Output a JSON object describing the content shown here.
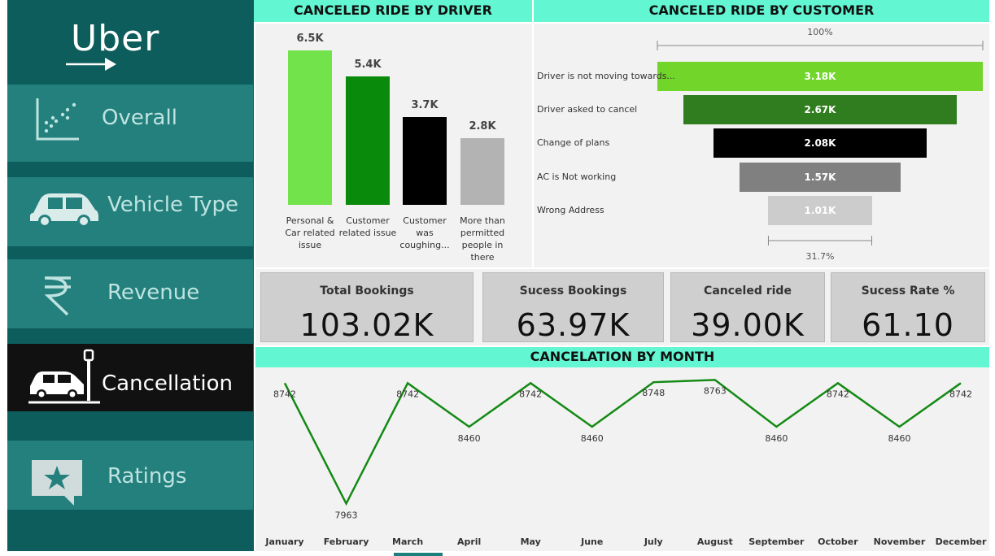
{
  "sidebar": {
    "logo": "Uber",
    "items": [
      {
        "label": "Overall",
        "icon": "scatter-chart-icon"
      },
      {
        "label": "Vehicle Type",
        "icon": "car-icon"
      },
      {
        "label": "Revenue",
        "icon": "rupee-icon"
      },
      {
        "label": "Cancellation",
        "icon": "car-crash-icon"
      },
      {
        "label": "Ratings",
        "icon": "star-comment-icon"
      }
    ],
    "active_index": 3
  },
  "headers": {
    "driver": "CANCELED RIDE BY DRIVER",
    "customer": "CANCELED RIDE BY CUSTOMER",
    "month": "CANCELATION BY MONTH"
  },
  "kpis": [
    {
      "title": "Total Bookings",
      "value": "103.02K"
    },
    {
      "title": "Sucess Bookings",
      "value": "63.97K"
    },
    {
      "title": "Canceled ride",
      "value": "39.00K"
    },
    {
      "title": "Sucess Rate %",
      "value": "61.10"
    }
  ],
  "chart_data": [
    {
      "type": "bar",
      "title": "CANCELED RIDE BY DRIVER",
      "categories": [
        "Personal & Car related issue",
        "Customer related issue",
        "Customer was coughing...",
        "More than permitted people in there"
      ],
      "values": [
        6.5,
        5.4,
        3.7,
        2.8
      ],
      "value_labels": [
        "6.5K",
        "5.4K",
        "3.7K",
        "2.8K"
      ],
      "colors": [
        "#72e34a",
        "#0a8a0a",
        "#000000",
        "#b3b3b3"
      ],
      "unit": "K"
    },
    {
      "type": "bar",
      "title": "CANCELED RIDE BY CUSTOMER",
      "categories": [
        "Driver is not moving towards...",
        "Driver asked to cancel",
        "Change of plans",
        "AC is Not working",
        "Wrong Address"
      ],
      "values": [
        3.18,
        2.67,
        2.08,
        1.57,
        1.01
      ],
      "value_labels": [
        "3.18K",
        "2.67K",
        "2.08K",
        "1.57K",
        "1.01K"
      ],
      "colors": [
        "#72d62a",
        "#2f7d1e",
        "#000000",
        "#808080",
        "#cccccc"
      ],
      "top_pct": "100%",
      "bottom_pct": "31.7%",
      "unit": "K"
    },
    {
      "type": "line",
      "title": "CANCELATION BY MONTH",
      "x": [
        "January",
        "February",
        "March",
        "April",
        "May",
        "June",
        "July",
        "August",
        "September",
        "October",
        "November",
        "December"
      ],
      "y": [
        8742,
        7963,
        8742,
        8460,
        8742,
        8460,
        8748,
        8763,
        8460,
        8742,
        8460,
        8742
      ],
      "color": "#138a13",
      "ylim": [
        7950,
        8770
      ]
    }
  ]
}
